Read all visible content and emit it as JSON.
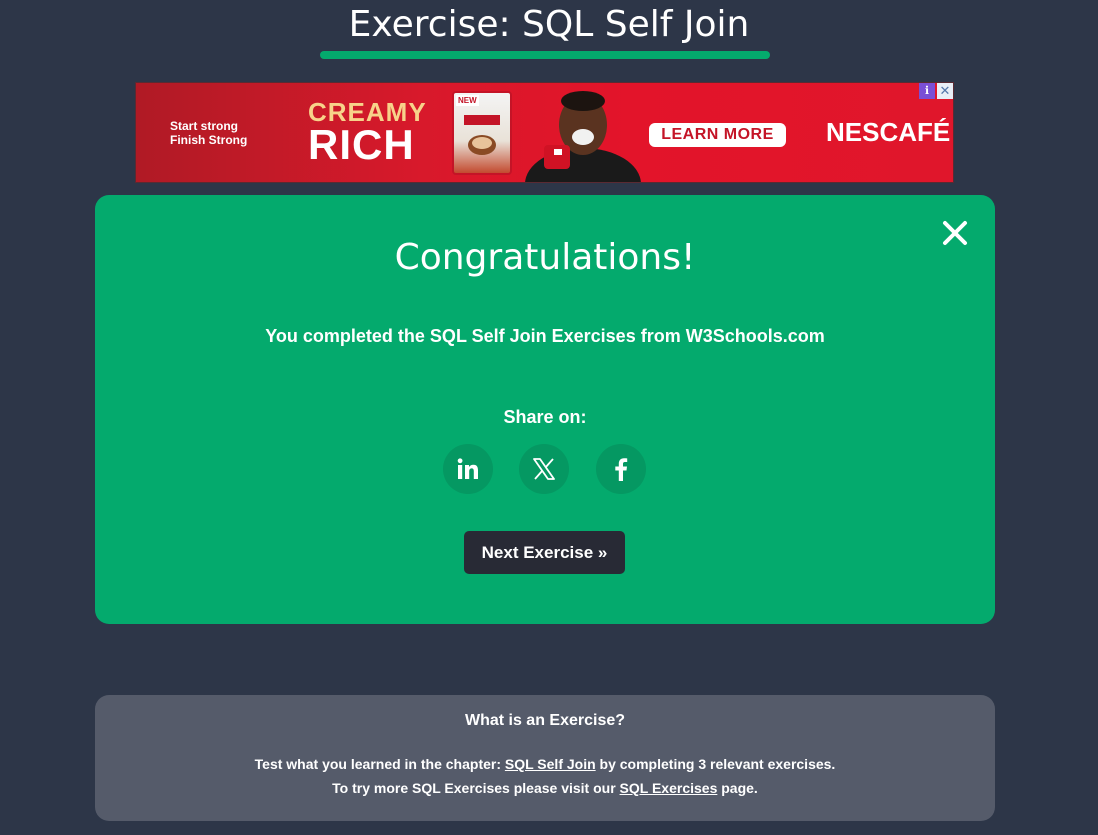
{
  "header": {
    "title": "Exercise: SQL Self Join",
    "accent_color": "#04aa6d"
  },
  "ad": {
    "tagline_line1": "Start strong",
    "tagline_line2": "Finish Strong",
    "headline_top": "CREAMY",
    "headline_bottom": "RICH",
    "product_badge": "NEW",
    "cta_label": "LEARN MORE",
    "brand": "NESCAFÉ",
    "adchoices_icon": "adchoices-icon",
    "close_icon": "close-icon",
    "colors": {
      "background": "#e3142a",
      "headline_top": "#f7d28a"
    }
  },
  "congrats": {
    "heading": "Congratulations!",
    "completed_text": "You completed the SQL Self Join Exercises from W3Schools.com",
    "share_label": "Share on:",
    "share_icons": [
      "linkedin-icon",
      "x-icon",
      "facebook-icon"
    ],
    "next_button_label": "Next Exercise »",
    "close_icon": "close-icon",
    "background": "#04aa6d"
  },
  "info": {
    "heading": "What is an Exercise?",
    "line1_prefix": "Test what you learned in the chapter: ",
    "line1_link": "SQL Self Join",
    "line1_suffix": " by completing 3 relevant exercises.",
    "line2_prefix": "To try more SQL Exercises please visit our ",
    "line2_link": "SQL Exercises",
    "line2_suffix": " page.",
    "background": "#555b6a"
  }
}
